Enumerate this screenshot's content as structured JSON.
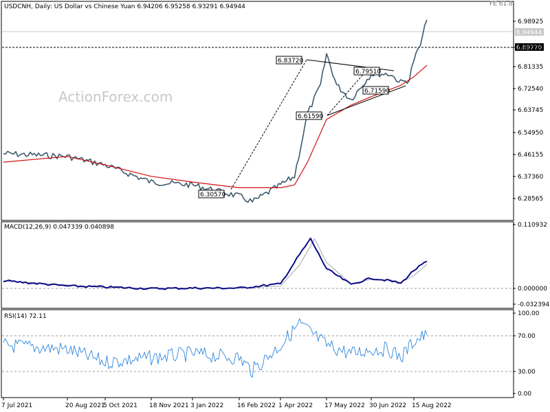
{
  "header": {
    "title": "USDCNH, Daily:  US Dollar vs Chinese Yuan  6.94206 6.95258 6.93291 6.94944",
    "fib_label": "FE 61.8",
    "watermark": "ActionForex.com"
  },
  "colors": {
    "candle": "#3d5a6c",
    "sma": "#d01010",
    "macd": "#0a0a8a",
    "macd_signal": "#a8a8a8",
    "rsi": "#2e86de",
    "trend": "#000000",
    "grid_dash": "#9a9a9a"
  },
  "chart_data": [
    {
      "panel": "main",
      "type": "line",
      "title": "USDCNH, Daily:  US Dollar vs Chinese Yuan  6.94206 6.95258 6.93291 6.94944",
      "ylim": [
        6.25,
        7.01
      ],
      "y_ticks": [
        "6.98925",
        "6.90130",
        "6.81335",
        "6.72540",
        "6.63745",
        "6.54950",
        "6.46155",
        "6.37360",
        "6.28565"
      ],
      "price_tags": [
        "6.94944",
        "6.89770"
      ],
      "x_ticks": [
        "7 Jul 2021",
        "20 Aug 2021",
        "5 Oct 2021",
        "18 Nov 2021",
        "3 Jan 2022",
        "16 Feb 2022",
        "1 Apr 2022",
        "17 May 2022",
        "30 Jun 2022",
        "15 Aug 2022"
      ],
      "series": [
        {
          "name": "price",
          "x": [
            "7 Jul 2021",
            "20 Aug 2021",
            "5 Oct 2021",
            "18 Nov 2021",
            "3 Jan 2022",
            "16 Feb 2022",
            "2 Mar 2022",
            "1 Apr 2022",
            "15 Apr 2022",
            "28 Apr 2022",
            "11 May 2022",
            "17 May 2022",
            "27 May 2022",
            "10 Jun 2022",
            "30 Jun 2022",
            "20 Jul 2022",
            "1 Aug 2022",
            "10 Aug 2022",
            "15 Aug 2022",
            "22 Aug 2022",
            "29 Aug 2022"
          ],
          "values": [
            6.48,
            6.47,
            6.44,
            6.38,
            6.37,
            6.33,
            6.31,
            6.37,
            6.4,
            6.62,
            6.72,
            6.83,
            6.72,
            6.67,
            6.76,
            6.76,
            6.73,
            6.74,
            6.81,
            6.86,
            6.95
          ]
        },
        {
          "name": "SMA",
          "x": [
            "7 Jul 2021",
            "20 Aug 2021",
            "5 Oct 2021",
            "18 Nov 2021",
            "3 Jan 2022",
            "16 Feb 2022",
            "1 Apr 2022",
            "15 Apr 2022",
            "28 Apr 2022",
            "17 May 2022",
            "10 Jun 2022",
            "30 Jun 2022",
            "1 Aug 2022",
            "15 Aug 2022",
            "29 Aug 2022"
          ],
          "values": [
            6.45,
            6.47,
            6.44,
            6.4,
            6.38,
            6.36,
            6.36,
            6.37,
            6.45,
            6.6,
            6.65,
            6.68,
            6.72,
            6.75,
            6.79
          ]
        }
      ],
      "annotations": [
        "6.83720",
        "6.79510",
        "6.71590",
        "6.61590",
        "6.30570"
      ]
    },
    {
      "panel": "macd",
      "type": "line",
      "title": "MACD(12,26,9) 0.047339 0.040898",
      "ylim": [
        -0.04,
        0.12
      ],
      "y_ticks": [
        "0.110932",
        "0.000000",
        "-0.032394"
      ],
      "series": [
        {
          "name": "MACD",
          "x": [
            "7 Jul 2021",
            "20 Aug 2021",
            "5 Oct 2021",
            "18 Nov 2021",
            "3 Jan 2022",
            "16 Feb 2022",
            "1 Apr 2022",
            "20 Apr 2022",
            "1 May 2022",
            "17 May 2022",
            "10 Jun 2022",
            "30 Jun 2022",
            "20 Jul 2022",
            "1 Aug 2022",
            "15 Aug 2022",
            "29 Aug 2022"
          ],
          "values": [
            0.01,
            0.0,
            -0.002,
            -0.005,
            -0.004,
            -0.004,
            0.004,
            0.06,
            0.09,
            0.033,
            0.003,
            0.015,
            0.01,
            0.005,
            0.03,
            0.047
          ]
        },
        {
          "name": "Signal",
          "x": [
            "7 Jul 2021",
            "20 Aug 2021",
            "5 Oct 2021",
            "18 Nov 2021",
            "3 Jan 2022",
            "16 Feb 2022",
            "1 Apr 2022",
            "20 Apr 2022",
            "5 May 2022",
            "17 May 2022",
            "10 Jun 2022",
            "30 Jun 2022",
            "20 Jul 2022",
            "1 Aug 2022",
            "15 Aug 2022",
            "29 Aug 2022"
          ],
          "values": [
            0.01,
            0.002,
            -0.003,
            -0.004,
            -0.004,
            -0.004,
            0.0,
            0.04,
            0.09,
            0.045,
            0.004,
            0.013,
            0.012,
            0.007,
            0.02,
            0.041
          ]
        }
      ]
    },
    {
      "panel": "rsi",
      "type": "line",
      "title": "RSI(14) 72.11",
      "ylim": [
        0,
        100
      ],
      "y_ticks": [
        "100.00",
        "70.00",
        "30.00",
        "0.00"
      ],
      "series": [
        {
          "name": "RSI",
          "x": [
            "7 Jul 2021",
            "20 Aug 2021",
            "5 Oct 2021",
            "18 Nov 2021",
            "3 Jan 2022",
            "16 Feb 2022",
            "2 Mar 2022",
            "1 Apr 2022",
            "20 Apr 2022",
            "17 May 2022",
            "10 Jun 2022",
            "30 Jun 2022",
            "20 Jul 2022",
            "1 Aug 2022",
            "15 Aug 2022",
            "29 Aug 2022"
          ],
          "values": [
            60,
            55,
            40,
            45,
            50,
            45,
            30,
            60,
            85,
            60,
            50,
            55,
            55,
            45,
            65,
            72.11
          ]
        }
      ]
    }
  ]
}
